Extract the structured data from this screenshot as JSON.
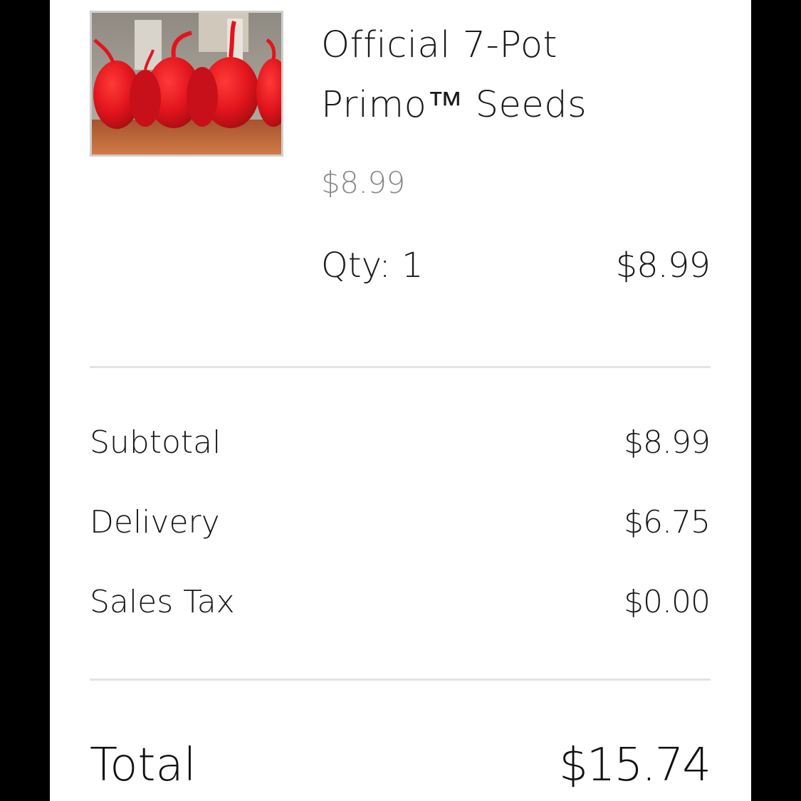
{
  "product": {
    "image_alt": "red peppers on a wooden table",
    "title_line1": "Official 7-Pot",
    "title_line2": "Primo™ Seeds",
    "unit_price": "$8.99",
    "quantity": "Qty: 1",
    "line_total": "$8.99"
  },
  "summary": {
    "subtotal_label": "Subtotal",
    "subtotal_value": "$8.99",
    "delivery_label": "Delivery",
    "delivery_value": "$6.75",
    "tax_label": "Sales Tax",
    "tax_value": "$0.00"
  },
  "total": {
    "label": "Total",
    "value": "$15.74"
  },
  "colors": {
    "background": "#ffffff",
    "frame": "#000000",
    "text": "#1a1a1a",
    "muted_text": "#8a8a8a",
    "divider": "#e3e3e3",
    "pepper": "#e0141c"
  }
}
